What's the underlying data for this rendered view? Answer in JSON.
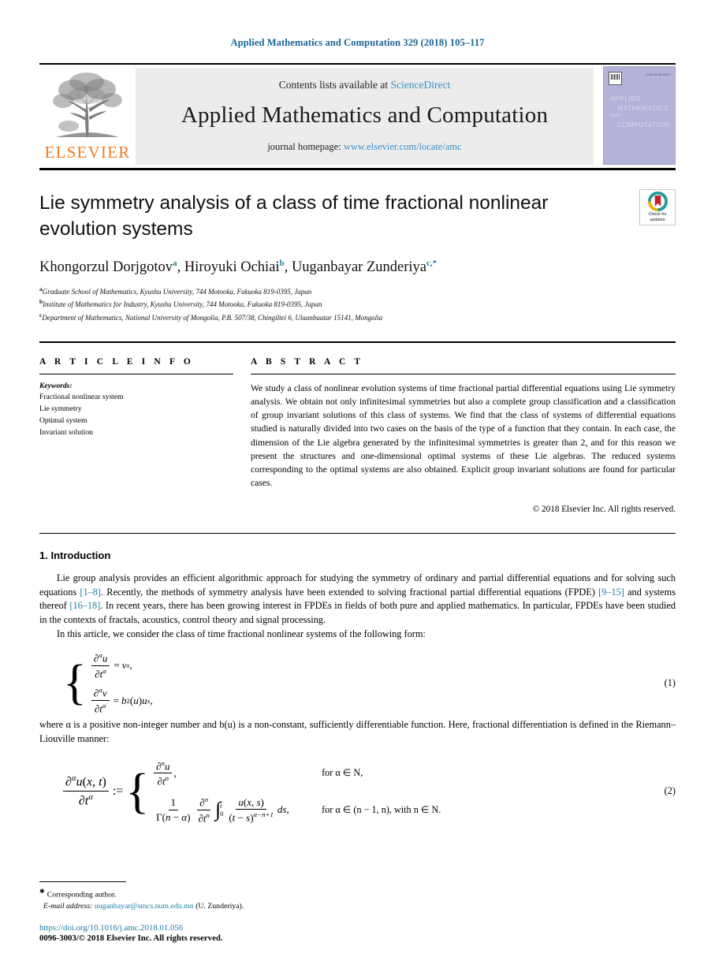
{
  "running_head": "Applied Mathematics and Computation 329 (2018) 105–117",
  "masthead": {
    "contents_prefix": "Contents lists available at",
    "sciencedirect": "ScienceDirect",
    "journal_title": "Applied Mathematics and Computation",
    "homepage_prefix": "journal homepage:",
    "homepage_url": "www.elsevier.com/locate/amc",
    "publisher": "ELSEVIER",
    "cover": {
      "line1": "APPLIED",
      "line2": "MATHEMATICS",
      "line3": "AND",
      "line4": "COMPUTATION",
      "issn": "ISSN 0096-3003"
    }
  },
  "article": {
    "title": "Lie symmetry analysis of a class of time fractional nonlinear evolution systems",
    "authors": [
      {
        "name": "Khongorzul Dorjgotov",
        "marker": "a"
      },
      {
        "name": "Hiroyuki Ochiai",
        "marker": "b"
      },
      {
        "name": "Uuganbayar Zunderiya",
        "marker": "c,*"
      }
    ],
    "affiliations": [
      {
        "marker": "a",
        "text": "Graduate School of Mathematics, Kyushu University, 744 Motooka, Fukuoka 819-0395, Japan"
      },
      {
        "marker": "b",
        "text": "Institute of Mathematics for Industry, Kyushu University, 744 Motooka, Fukuoka 819-0395, Japan"
      },
      {
        "marker": "c",
        "text": "Department of Mathematics, National University of Mongolia, P.B. 507/38, Chingiltei 6, Ulaanbaatar 15141, Mongolia"
      }
    ],
    "crossmark_label_line1": "Check for",
    "crossmark_label_line2": "updates"
  },
  "info": {
    "heading": "A R T I C L E    I N F O",
    "keywords_label": "Keywords:",
    "keywords": [
      "Fractional nonlinear system",
      "Lie symmetry",
      "Optimal system",
      "Invariant solution"
    ]
  },
  "abstract": {
    "heading": "A B S T R A C T",
    "text": "We study a class of nonlinear evolution systems of time fractional partial differential equations using Lie symmetry analysis. We obtain not only infinitesimal symmetries but also a complete group classification and a classification of group invariant solutions of this class of systems. We find that the class of systems of differential equations studied is naturally divided into two cases on the basis of the type of a function that they contain. In each case, the dimension of the Lie algebra generated by the infinitesimal symmetries is greater than 2, and for this reason we present the structures and one-dimensional optimal systems of these Lie algebras. The reduced systems corresponding to the optimal systems are also obtained. Explicit group invariant solutions are found for particular cases.",
    "copyright": "© 2018 Elsevier Inc. All rights reserved."
  },
  "body": {
    "section_number_title": "1. Introduction",
    "para1_a": "Lie group analysis provides an efficient algorithmic approach for studying the symmetry of ordinary and partial differential equations and for solving such equations ",
    "para1_ref1": "[1–8]",
    "para1_b": ". Recently, the methods of symmetry analysis have been extended to solving fractional partial differential equations (FPDE) ",
    "para1_ref2": "[9–15]",
    "para1_c": " and systems thereof ",
    "para1_ref3": "[16–18]",
    "para1_d": ". In recent years, there has been growing interest in FPDEs in fields of both pure and applied mathematics. In particular, FPDEs have been studied in the contexts of fractals, acoustics, control theory and signal processing.",
    "para2": "In this article, we consider the class of time fractional nonlinear systems of the following form:",
    "para3": "where α is a positive non-integer number and b(u) is a non-constant, sufficiently differentiable function. Here, fractional differentiation is defined in the Riemann–Liouville manner:"
  },
  "equations": {
    "eq1_number": "(1)",
    "eq2_number": "(2)",
    "eq1": {
      "row1": "∂^α u / ∂t^α = v_x ,",
      "row2": "∂^α v / ∂t^α = b²(u) u_x ,"
    },
    "eq2": {
      "lhs": "∂^α u(x,t) / ∂t^α :=",
      "case1": "∂^n u / ∂t^n ,",
      "case1_cond": "for α ∈ N,",
      "case2": "1 / Γ(n − α) · ∂^n/∂t^n ∫_0^t u(x,s)/(t − s)^{α−n+1} ds,",
      "case2_cond": "for α ∈ (n − 1, n),  with n ∈ N."
    }
  },
  "footer": {
    "corresponding": "Corresponding author.",
    "email_label": "E-mail address:",
    "email": "uuganbayar@smcs.num.edu.mn",
    "email_owner": "(U. Zunderiya).",
    "doi": "https://doi.org/10.1016/j.amc.2018.01.056",
    "issn_copyright": "0096-3003/© 2018 Elsevier Inc. All rights reserved."
  },
  "colors": {
    "link": "#1a7fa8",
    "masthead_link": "#3a8fc4",
    "elsevier_orange": "#F47B20",
    "cover_bg": "#b3b3d9",
    "band_bg": "#ececec"
  }
}
